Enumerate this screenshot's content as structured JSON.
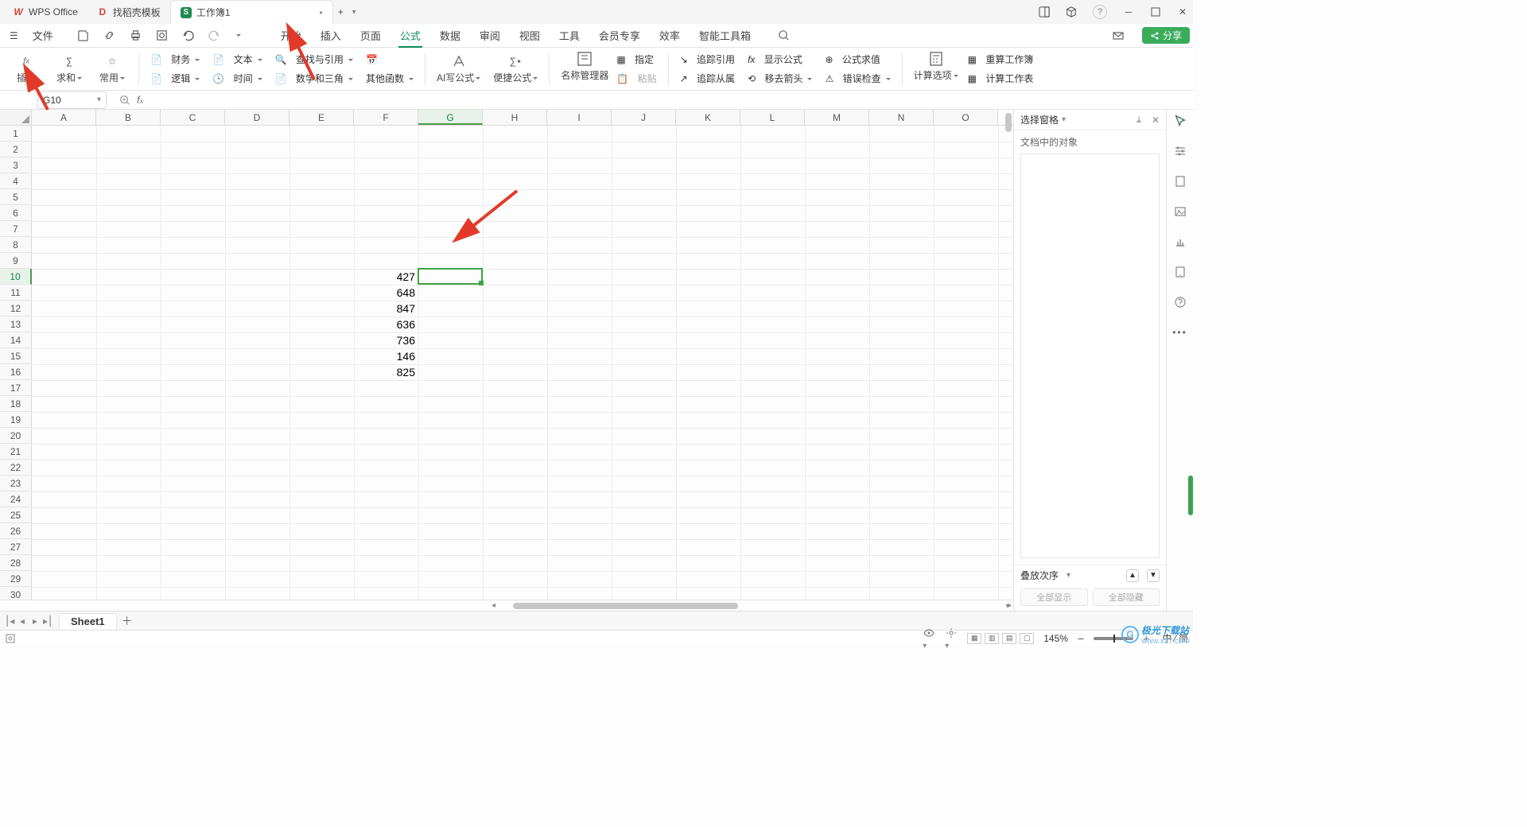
{
  "titlebar": {
    "tabs": [
      {
        "label": "WPS Office",
        "kind": "wps"
      },
      {
        "label": "找稻壳模板",
        "kind": "daoke"
      },
      {
        "label": "工作簿1",
        "kind": "sheet",
        "active": true,
        "dirty": "•"
      }
    ],
    "add": "+"
  },
  "menubar": {
    "file_menu": "文件",
    "left_icons": [
      "menu",
      "save",
      "print-share",
      "print",
      "undo",
      "redo",
      "dd"
    ],
    "tabs": {
      "start": "开始",
      "insert": "插入",
      "page": "页面",
      "formula": "公式",
      "data": "数据",
      "review": "审阅",
      "view": "视图",
      "tools": "工具",
      "member": "会员专享",
      "efficiency": "效率",
      "smart": "智能工具箱"
    },
    "search_icon": "search",
    "right": {
      "mail_icon": "mail",
      "share_btn": "分享"
    }
  },
  "ribbon": {
    "insert_fn": "插入",
    "sum": "求和",
    "common": "常用",
    "grid": {
      "finance": "财务",
      "text": "文本",
      "lookup": "查找与引用",
      "date": "日期",
      "logic": "逻辑",
      "time": "时间",
      "math": "数学和三角",
      "other": "其他函数"
    },
    "ai": "AI写公式",
    "handy": "便捷公式",
    "name_mgr": "名称管理器",
    "define": "指定",
    "paste": "粘贴",
    "trace_ref": "追踪引用",
    "show_formula": "显示公式",
    "formula_eval": "公式求值",
    "trace_dep": "追踪从属",
    "remove_arrow": "移去箭头",
    "error_check": "错误检查",
    "calc_opts": "计算选项",
    "recalc_sheet": "重算工作簿",
    "calc_sheet": "计算工作表"
  },
  "namebox": {
    "value": "G10"
  },
  "columns": [
    "A",
    "B",
    "C",
    "D",
    "E",
    "F",
    "G",
    "H",
    "I",
    "J",
    "K",
    "L",
    "M",
    "N",
    "O"
  ],
  "row_count": 30,
  "active": {
    "col_index": 6,
    "row_index": 9,
    "col_label": "G",
    "row_label": "10"
  },
  "cells": {
    "F10": "427",
    "F11": "648",
    "F12": "847",
    "F13": "636",
    "F14": "736",
    "F15": "146",
    "F16": "825"
  },
  "right_panel": {
    "title": "选择窗格",
    "subtitle": "文档中的对象",
    "stack_order": "叠放次序",
    "btn_up": "▲",
    "btn_down": "▼",
    "show_all": "全部显示",
    "hide_all": "全部隐藏"
  },
  "sheetbar": {
    "sheet": "Sheet1",
    "nav": [
      "⎮◂",
      "◂",
      "▸",
      "▸⎮"
    ]
  },
  "statusbar": {
    "settings_icon": "settings",
    "mic_icon": "mic",
    "zoom": "145%",
    "ime": "中 ⁄ 简"
  },
  "watermark": {
    "brand": "极光下载站",
    "url": "www.xz7.com"
  }
}
